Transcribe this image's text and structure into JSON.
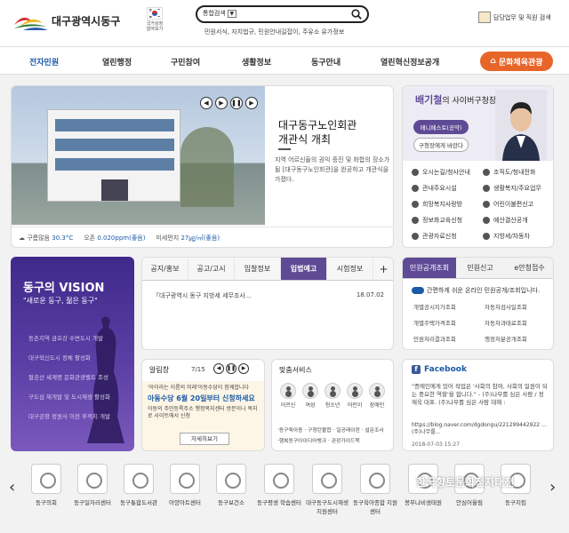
{
  "header": {
    "logo_text": "대구광역시동구",
    "flag_caption": "국가상징 알아보기",
    "search_select": "통합검색",
    "quick_links": "민원서식, 자치법규, 민원안내길잡이, 주유소 유가정보",
    "dept_label": "담당업무 및 직원 검색"
  },
  "nav": {
    "items": [
      "전자민원",
      "열린행정",
      "구민참여",
      "생활정보",
      "동구안내",
      "열린혁신정보공개"
    ],
    "culture": "문화체육관광"
  },
  "hero": {
    "title": "대구동구노인회관\n개관식 개최",
    "desc": "지역 어르신들의 권익 증진 및 화합의 장소가 될 [대구동구노인회관]을 완공하고 개관식을 가졌다.",
    "weather": [
      {
        "label": "구름많음",
        "value": "30.3°C"
      },
      {
        "label": "오존",
        "value": "0.020ppm(좋음)"
      },
      {
        "label": "미세먼지",
        "value": "27㎍/㎥(좋음)"
      }
    ]
  },
  "mayor": {
    "name": "배기철",
    "sub": "의 사이버구청장실",
    "btn1": "매니페스토(공약)",
    "btn2": "구청장에게 바란다",
    "links": [
      "오시는길/청사안내",
      "조직도/청내전화",
      "관내주요시설",
      "생활복지/주요업무",
      "희망복지사랑방",
      "어린이불편신고",
      "정보화교육신청",
      "예산결산공개",
      "관광자료신청",
      "지방세/차동차"
    ]
  },
  "vision": {
    "title": "동구의 VISION",
    "sub": "\"새로운 동구, 젊은 동구\"",
    "items": [
      "동촌지역 금호강 수변도시 개발",
      "대구혁신도시 정체 활성화",
      "팔공산 세계명 문화관광벨트 조성",
      "구도심 재개발 및 도시재생 활성화",
      "대구공항 정원사 이전 후적지 개발"
    ]
  },
  "tabs": {
    "items": [
      "공지/홍보",
      "공고/고시",
      "입찰정보",
      "입법예고",
      "시험정보"
    ],
    "plus": "+",
    "notice_title": "「대구광역시 동구 지방세 세무조사...",
    "notice_date": "18.07.02"
  },
  "minwon": {
    "tabs": [
      "민원공개조회",
      "민원신고",
      "e안청접수"
    ],
    "intro": "간편하게 쉬운 온라인 민원공개/조회입니다.",
    "links": [
      "개별공시지가조회",
      "자동차검사일조회",
      "개별주택가격조회",
      "자동차과태료조회",
      "민원처리결과조회",
      "행정처분공개조회"
    ]
  },
  "alim": {
    "title": "알림창",
    "page": "7/15",
    "line1": "'아이라는 이름의 미래'아동수당이 함께합니다",
    "line2": "아동수당 6월 20일부터 신청하세요",
    "line3": "아동의 주민등록주소 행정복지센터 방문이나 복지로 사이트에서 신청",
    "btn": "자세히보기"
  },
  "services": {
    "title": "맞춤서비스",
    "items": [
      "어르신",
      "여성",
      "청소년",
      "어린이",
      "장애인"
    ],
    "line1": "·동구육아종 · 구청탄불합 · 일공래이란 · 설문조사",
    "line2": "·행복동구아이디어뱅크 · 관광가이드북"
  },
  "facebook": {
    "title": "Facebook",
    "text": "\"증에인에게 있어 작업은 '사회의 참여, 사회의 일원이 되는 중요한 역할'을 합니다.\" - (주)나무를 심은 사람 / 정재욱 대표. (주)나무를 심은 사람 대해 :",
    "link": "https://blog.naver.com/dgdongu/221299442922 …(주)나무를...",
    "date": "2018-07-03 15:27"
  },
  "banners": [
    "동구의회",
    "동구일자리센터",
    "동구통합도서관",
    "아양아트센터",
    "동구보건소",
    "동구평생 학습센터",
    "대구동구도시재생 지원센터",
    "동구육아종합 지원센터",
    "봉무나비생태원",
    "안심어울림",
    "동구지킴"
  ],
  "watermark": "한국향토문화전자대전",
  "colors": {
    "accent": "#5f4a96",
    "brand_blue": "#1b5aa6",
    "culture": "#e8652a"
  }
}
